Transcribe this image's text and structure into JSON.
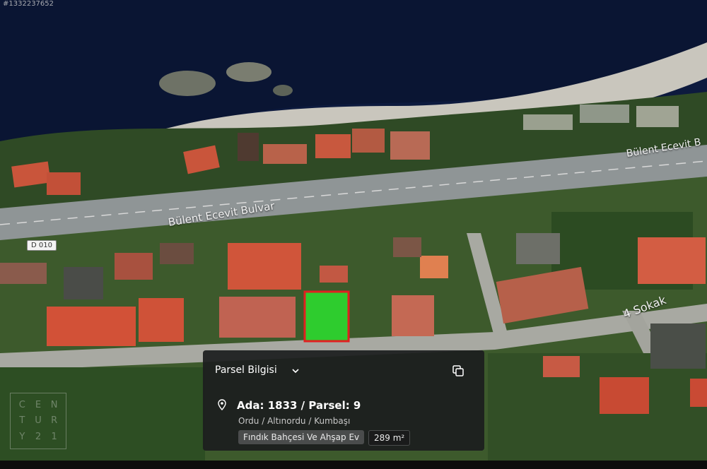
{
  "map": {
    "image_id": "#1332237652",
    "labels": {
      "road_main_left": "Bülent Ecevit Bulvar",
      "road_main_right": "Bülent Ecevit B",
      "street": "4 Sokak",
      "highway_badge": "D 010"
    },
    "highlight_color": "#2ecc2e",
    "highlight_border": "#e02020"
  },
  "watermark": {
    "letters": [
      "C",
      "E",
      "N",
      "T",
      "U",
      "R",
      "Y",
      "2",
      "1"
    ]
  },
  "parcel_panel": {
    "title": "Parsel Bilgisi",
    "parcel_id": "Ada: 1833 / Parsel: 9",
    "location": "Ordu / Altınordu / Kumbaşı",
    "usage": "Fındık Bahçesi Ve Ahşap Ev",
    "area": "289 m²",
    "icons": {
      "header_toggle": "chevron-down-icon",
      "copy": "copy-icon",
      "location": "map-pin-icon"
    }
  }
}
